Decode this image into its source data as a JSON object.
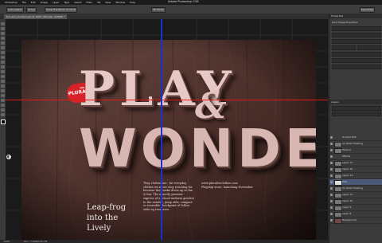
{
  "app": {
    "menu": [
      "Photoshop",
      "File",
      "Edit",
      "Image",
      "Layer",
      "Type",
      "Select",
      "Filter",
      "3D",
      "View",
      "Window",
      "Help"
    ],
    "window_title": "Adobe Photoshop CS6"
  },
  "options": {
    "auto_select": "Auto-Select:",
    "group_value": "Group",
    "show_transform": "Show Transform Controls",
    "mode_3d": "3D Mode:",
    "workspace": "Essentials"
  },
  "document_tab": {
    "label": "Fun-ads_mocked.psd @ 100% (Wonder, RGB/8) *"
  },
  "artwork": {
    "brand_small": "the",
    "brand": "PLURALIST",
    "headline_top": "PLAY",
    "ampersand": "&",
    "headline_bottom": "WONDER",
    "tagline": [
      "Leap-frog",
      "into the",
      "Lively"
    ],
    "body_copy": "They clothes are - be everyday clothes we never stop reaching for because they make dress up so fun & fun. The ownerly promise - express of a school uniform goodest to the notable, jump able, compact vs wearable checkpoint of follow wide-eg treasures.",
    "info_url": "www.pluralistclothes.com",
    "info_text": "Flagship store, launching November"
  },
  "right_panel": {
    "properties_title": "Properties",
    "live_shape": "Live Shape Properties",
    "layers_title": "Layers",
    "layers": [
      {
        "name": "Guided Text"
      },
      {
        "name": "Scripted Heading"
      },
      {
        "name": "Texture"
      },
      {
        "name": "Effects"
      },
      {
        "name": "Layer 17"
      },
      {
        "name": "Layer 16"
      },
      {
        "name": "Layer 14"
      },
      {
        "name": "Text"
      },
      {
        "name": "Scripted Heading"
      },
      {
        "name": "Layer 11"
      },
      {
        "name": "Layer 10"
      },
      {
        "name": "Layer 9"
      },
      {
        "name": "Layer 8"
      },
      {
        "name": "Background"
      }
    ]
  },
  "status": {
    "zoom": "100%",
    "doc": "Doc: 7.03M/155.7M"
  }
}
